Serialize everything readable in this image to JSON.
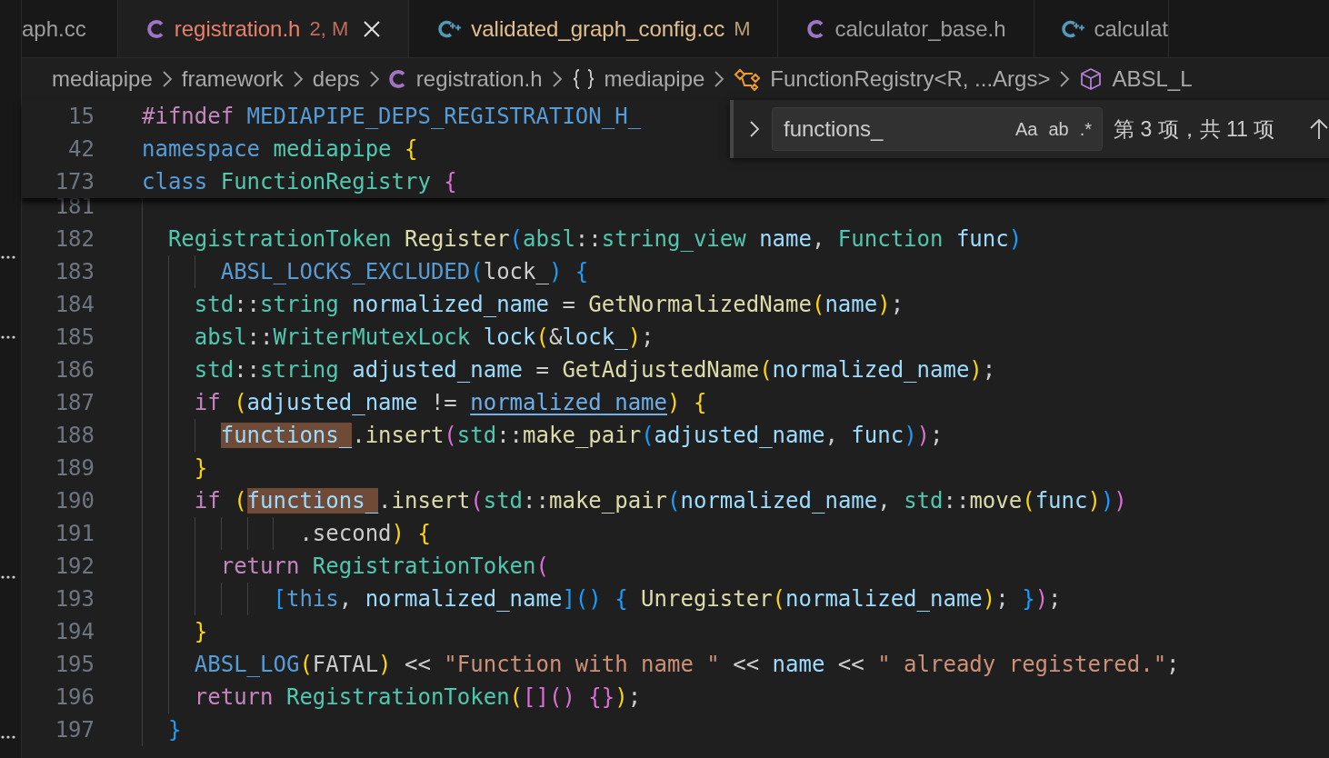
{
  "tabs": [
    {
      "label": "aph.cc",
      "color": "#9d9d9d",
      "selected": false
    },
    {
      "kind": "c",
      "label": "registration.h",
      "status": "2, M",
      "color": "#e8806b",
      "selected": true
    },
    {
      "kind": "cpp",
      "label": "validated_graph_config.cc",
      "status": "M",
      "color": "#e2c08d",
      "selected": false
    },
    {
      "kind": "c",
      "label": "calculator_base.h",
      "color": "#9d9d9d",
      "selected": false
    },
    {
      "kind": "cpp",
      "label": "calculat",
      "color": "#9d9d9d",
      "selected": false
    }
  ],
  "breadcrumbs": [
    {
      "kind": "folder",
      "label": "mediapipe"
    },
    {
      "kind": "folder",
      "label": "framework"
    },
    {
      "kind": "folder",
      "label": "deps"
    },
    {
      "kind": "file",
      "label": "registration.h"
    },
    {
      "kind": "namespace",
      "label": "mediapipe"
    },
    {
      "kind": "class",
      "label": "FunctionRegistry<R, ...Args>"
    },
    {
      "kind": "field",
      "label": "ABSL_L"
    }
  ],
  "find": {
    "value": "functions_",
    "toggles": [
      {
        "label": "Aa",
        "on": false
      },
      {
        "label": "ab",
        "on": false
      },
      {
        "label": ".*",
        "on": false
      }
    ],
    "result": "第 3 项，共 11 项"
  },
  "sticky_lines": [
    {
      "number": "15",
      "tokens": [
        {
          "text": "#ifndef",
          "color": "#c586c0"
        },
        {
          "text": " MEDIAPIPE_DEPS_REGISTRATION_H_",
          "color": "#569cd6"
        }
      ]
    },
    {
      "number": "42",
      "tokens": [
        {
          "text": "namespace",
          "color": "#569cd6"
        },
        {
          "text": " mediapipe",
          "color": "#4ec9b0"
        },
        {
          "text": " {",
          "color": "#ffd700"
        }
      ]
    },
    {
      "number": "173",
      "tokens": [
        {
          "text": "class",
          "color": "#569cd6"
        },
        {
          "text": " FunctionRegistry",
          "color": "#4ec9b0"
        },
        {
          "text": " {",
          "color": "#da70d6"
        }
      ]
    }
  ],
  "lines": [
    {
      "number": "181"
    },
    {
      "number": "182",
      "tokens": [
        {
          "text": "  RegistrationToken",
          "color": "#4ec9b0"
        },
        {
          "text": " Register",
          "color": "#dcdcaa"
        },
        {
          "text": "(",
          "color": "#179fff"
        },
        {
          "text": "absl",
          "color": "#4ec9b0"
        },
        {
          "text": "::",
          "color": "#cccccc"
        },
        {
          "text": "string_view",
          "color": "#4ec9b0"
        },
        {
          "text": " name",
          "color": "#9cdcfe"
        },
        {
          "text": ",",
          "color": "#cccccc"
        },
        {
          "text": " Function",
          "color": "#4ec9b0"
        },
        {
          "text": " func",
          "color": "#9cdcfe"
        },
        {
          "text": ")",
          "color": "#179fff"
        }
      ]
    },
    {
      "number": "183",
      "tokens": [
        {
          "text": "      ABSL_LOCKS_EXCLUDED",
          "color": "#569cd6"
        },
        {
          "text": "(",
          "color": "#179fff"
        },
        {
          "text": "lock_",
          "color": "#cccccc"
        },
        {
          "text": ")",
          "color": "#179fff"
        },
        {
          "text": " {",
          "color": "#179fff"
        }
      ]
    },
    {
      "number": "184",
      "tokens": [
        {
          "text": "    std",
          "color": "#4ec9b0"
        },
        {
          "text": "::",
          "color": "#cccccc"
        },
        {
          "text": "string",
          "color": "#4ec9b0"
        },
        {
          "text": " normalized_name",
          "color": "#9cdcfe"
        },
        {
          "text": " =",
          "color": "#cccccc"
        },
        {
          "text": " GetNormalizedName",
          "color": "#dcdcaa"
        },
        {
          "text": "(",
          "color": "#ffd700"
        },
        {
          "text": "name",
          "color": "#9cdcfe"
        },
        {
          "text": ")",
          "color": "#ffd700"
        },
        {
          "text": ";",
          "color": "#cccccc"
        }
      ]
    },
    {
      "number": "185",
      "tokens": [
        {
          "text": "    absl",
          "color": "#4ec9b0"
        },
        {
          "text": "::",
          "color": "#cccccc"
        },
        {
          "text": "WriterMutexLock",
          "color": "#4ec9b0"
        },
        {
          "text": " lock",
          "color": "#9cdcfe"
        },
        {
          "text": "(",
          "color": "#ffd700"
        },
        {
          "text": "&",
          "color": "#cccccc"
        },
        {
          "text": "lock_",
          "color": "#9cdcfe"
        },
        {
          "text": ")",
          "color": "#ffd700"
        },
        {
          "text": ";",
          "color": "#cccccc"
        }
      ]
    },
    {
      "number": "186",
      "tokens": [
        {
          "text": "    std",
          "color": "#4ec9b0"
        },
        {
          "text": "::",
          "color": "#cccccc"
        },
        {
          "text": "string",
          "color": "#4ec9b0"
        },
        {
          "text": " adjusted_name",
          "color": "#9cdcfe"
        },
        {
          "text": " =",
          "color": "#cccccc"
        },
        {
          "text": " GetAdjustedName",
          "color": "#dcdcaa"
        },
        {
          "text": "(",
          "color": "#ffd700"
        },
        {
          "text": "normalized_name",
          "color": "#9cdcfe"
        },
        {
          "text": ")",
          "color": "#ffd700"
        },
        {
          "text": ";",
          "color": "#cccccc"
        }
      ]
    },
    {
      "number": "187",
      "tokens": [
        {
          "text": "    if",
          "color": "#c586c0"
        },
        {
          "text": " (",
          "color": "#ffd700"
        },
        {
          "text": "adjusted_name",
          "color": "#9cdcfe"
        },
        {
          "text": " != ",
          "color": "#cccccc"
        },
        {
          "text": "normalized_name",
          "color": "#6fb0e8",
          "underline": true
        },
        {
          "text": ")",
          "color": "#ffd700"
        },
        {
          "text": " {",
          "color": "#ffd700"
        }
      ]
    },
    {
      "number": "188",
      "tokens": [
        {
          "text": "      functions_",
          "match": true
        },
        {
          "text": ".",
          "color": "#cccccc"
        },
        {
          "text": "insert",
          "color": "#dcdcaa"
        },
        {
          "text": "(",
          "color": "#da70d6"
        },
        {
          "text": "std",
          "color": "#4ec9b0"
        },
        {
          "text": "::",
          "color": "#cccccc"
        },
        {
          "text": "make_pair",
          "color": "#dcdcaa"
        },
        {
          "text": "(",
          "color": "#179fff"
        },
        {
          "text": "adjusted_name",
          "color": "#9cdcfe"
        },
        {
          "text": ",",
          "color": "#cccccc"
        },
        {
          "text": " func",
          "color": "#9cdcfe"
        },
        {
          "text": ")",
          "color": "#179fff"
        },
        {
          "text": ")",
          "color": "#da70d6"
        },
        {
          "text": ";",
          "color": "#cccccc"
        }
      ]
    },
    {
      "number": "189",
      "tokens": [
        {
          "text": "    }",
          "color": "#ffd700"
        }
      ]
    },
    {
      "number": "190",
      "tokens": [
        {
          "text": "    if",
          "color": "#c586c0"
        },
        {
          "text": " (",
          "color": "#ffd700"
        },
        {
          "text": "functions_",
          "match": true
        },
        {
          "text": ".",
          "color": "#cccccc"
        },
        {
          "text": "insert",
          "color": "#dcdcaa"
        },
        {
          "text": "(",
          "color": "#da70d6"
        },
        {
          "text": "std",
          "color": "#4ec9b0"
        },
        {
          "text": "::",
          "color": "#cccccc"
        },
        {
          "text": "make_pair",
          "color": "#dcdcaa"
        },
        {
          "text": "(",
          "color": "#179fff"
        },
        {
          "text": "normalized_name",
          "color": "#9cdcfe"
        },
        {
          "text": ",",
          "color": "#cccccc"
        },
        {
          "text": " std",
          "color": "#4ec9b0"
        },
        {
          "text": "::",
          "color": "#cccccc"
        },
        {
          "text": "move",
          "color": "#dcdcaa"
        },
        {
          "text": "(",
          "color": "#ffd700"
        },
        {
          "text": "func",
          "color": "#9cdcfe"
        },
        {
          "text": ")",
          "color": "#ffd700"
        },
        {
          "text": ")",
          "color": "#179fff"
        },
        {
          "text": ")",
          "color": "#da70d6"
        }
      ]
    },
    {
      "number": "191",
      "tokens": [
        {
          "text": "            .second",
          "color": "#cccccc"
        },
        {
          "text": ")",
          "color": "#ffd700"
        },
        {
          "text": " {",
          "color": "#ffd700"
        }
      ]
    },
    {
      "number": "192",
      "tokens": [
        {
          "text": "      return",
          "color": "#c586c0"
        },
        {
          "text": " RegistrationToken",
          "color": "#4ec9b0"
        },
        {
          "text": "(",
          "color": "#da70d6"
        }
      ]
    },
    {
      "number": "193",
      "tokens": [
        {
          "text": "          [",
          "color": "#179fff"
        },
        {
          "text": "this",
          "color": "#569cd6"
        },
        {
          "text": ",",
          "color": "#cccccc"
        },
        {
          "text": " normalized_name",
          "color": "#9cdcfe"
        },
        {
          "text": "]()",
          "color": "#179fff"
        },
        {
          "text": " {",
          "color": "#179fff"
        },
        {
          "text": " Unregister",
          "color": "#dcdcaa"
        },
        {
          "text": "(",
          "color": "#ffd700"
        },
        {
          "text": "normalized_name",
          "color": "#9cdcfe"
        },
        {
          "text": ")",
          "color": "#ffd700"
        },
        {
          "text": ";",
          "color": "#cccccc"
        },
        {
          "text": " }",
          "color": "#179fff"
        },
        {
          "text": ")",
          "color": "#da70d6"
        },
        {
          "text": ";",
          "color": "#cccccc"
        }
      ]
    },
    {
      "number": "194",
      "tokens": [
        {
          "text": "    }",
          "color": "#ffd700"
        }
      ]
    },
    {
      "number": "195",
      "tokens": [
        {
          "text": "    ABSL_LOG",
          "color": "#569cd6"
        },
        {
          "text": "(",
          "color": "#ffd700"
        },
        {
          "text": "FATAL",
          "color": "#cccccc"
        },
        {
          "text": ")",
          "color": "#ffd700"
        },
        {
          "text": " <<",
          "color": "#cccccc"
        },
        {
          "text": " \"Function with name \"",
          "color": "#ce9178"
        },
        {
          "text": " <<",
          "color": "#cccccc"
        },
        {
          "text": " name",
          "color": "#9cdcfe"
        },
        {
          "text": " <<",
          "color": "#cccccc"
        },
        {
          "text": " \" already registered.\"",
          "color": "#ce9178"
        },
        {
          "text": ";",
          "color": "#cccccc"
        }
      ]
    },
    {
      "number": "196",
      "tokens": [
        {
          "text": "    return",
          "color": "#c586c0"
        },
        {
          "text": " RegistrationToken",
          "color": "#4ec9b0"
        },
        {
          "text": "(",
          "color": "#ffd700"
        },
        {
          "text": "[]()",
          "color": "#da70d6"
        },
        {
          "text": " {}",
          "color": "#da70d6"
        },
        {
          "text": ")",
          "color": "#ffd700"
        },
        {
          "text": ";",
          "color": "#cccccc"
        }
      ]
    },
    {
      "number": "197",
      "tokens": [
        {
          "text": "  }",
          "color": "#179fff"
        }
      ]
    }
  ]
}
